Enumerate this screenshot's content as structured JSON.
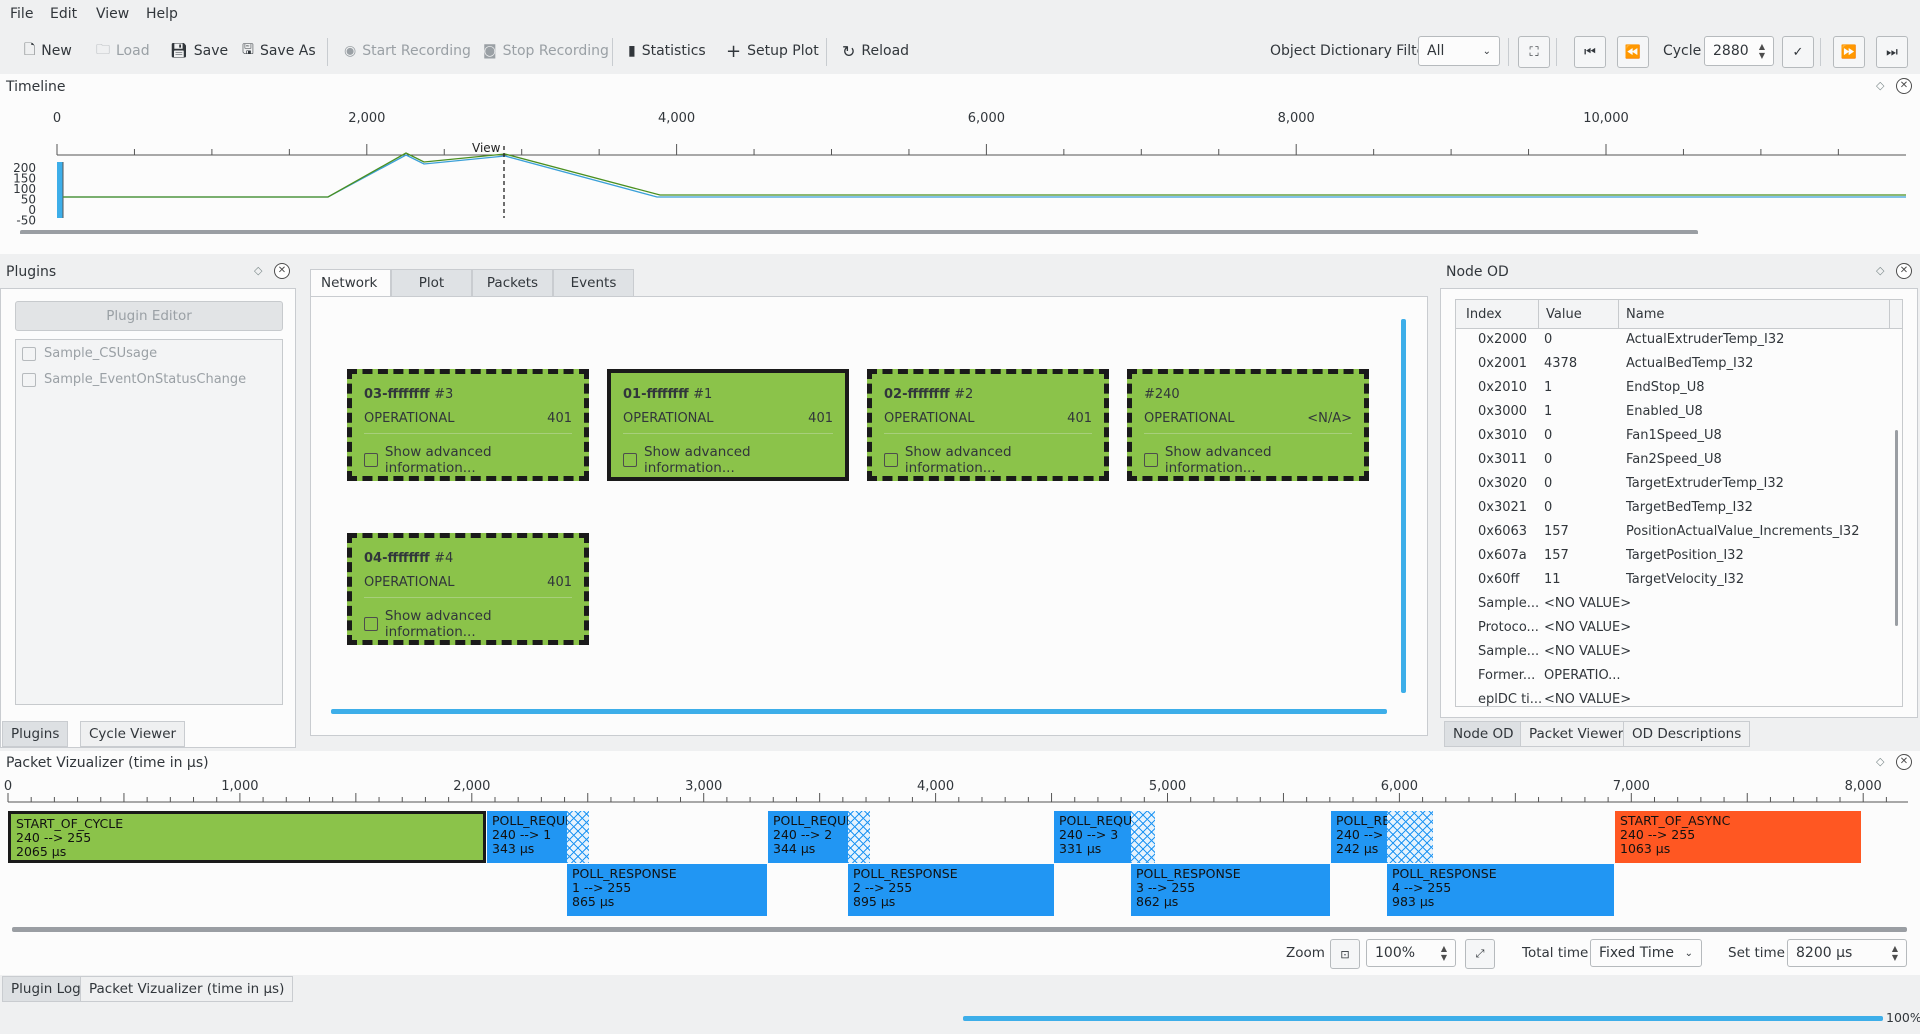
{
  "menu": {
    "file": "File",
    "edit": "Edit",
    "view": "View",
    "help": "Help"
  },
  "toolbar": {
    "new": "New",
    "load": "Load",
    "save": "Save",
    "save_as": "Save As",
    "start_recording": "Start Recording",
    "stop_recording": "Stop Recording",
    "statistics": "Statistics",
    "setup_plot": "Setup Plot",
    "reload": "Reload",
    "od_filter_label": "Object Dictionary Filter",
    "od_filter_value": "All",
    "cycle_label": "Cycle",
    "cycle_value": "2880"
  },
  "timeline": {
    "title": "Timeline",
    "x_ticks": [
      "0",
      "2,000",
      "4,000",
      "6,000",
      "8,000",
      "10,000"
    ],
    "y_ticks": [
      "200",
      "150",
      "100",
      "50",
      "0",
      "-50"
    ],
    "view_label": "View"
  },
  "plugins": {
    "title": "Plugins",
    "editor_button": "Plugin Editor",
    "items": [
      {
        "label": "Sample_CSUsage"
      },
      {
        "label": "Sample_EventOnStatusChange"
      }
    ],
    "tabs": [
      "Plugins",
      "Cycle Viewer"
    ]
  },
  "center_tabs": [
    "Network",
    "Plot",
    "Packets",
    "Events"
  ],
  "nodes": [
    {
      "title": "03-ffffffff",
      "num": "#3",
      "state": "OPERATIONAL",
      "value": "401",
      "adv": "Show advanced information..."
    },
    {
      "title": "01-ffffffff",
      "num": "#1",
      "state": "OPERATIONAL",
      "value": "401",
      "adv": "Show advanced information..."
    },
    {
      "title": "02-ffffffff",
      "num": "#2",
      "state": "OPERATIONAL",
      "value": "401",
      "adv": "Show advanced information..."
    },
    {
      "title": "",
      "num": "#240",
      "state": "OPERATIONAL",
      "value": "<N/A>",
      "adv": "Show advanced information..."
    },
    {
      "title": "04-ffffffff",
      "num": "#4",
      "state": "OPERATIONAL",
      "value": "401",
      "adv": "Show advanced information..."
    }
  ],
  "node_od": {
    "title": "Node OD",
    "headers": [
      "Index",
      "Value",
      "Name"
    ],
    "rows": [
      {
        "index": "0x2000",
        "value": "0",
        "name": "ActualExtruderTemp_I32"
      },
      {
        "index": "0x2001",
        "value": "4378",
        "name": "ActualBedTemp_I32"
      },
      {
        "index": "0x2010",
        "value": "1",
        "name": "EndStop_U8"
      },
      {
        "index": "0x3000",
        "value": "1",
        "name": "Enabled_U8"
      },
      {
        "index": "0x3010",
        "value": "0",
        "name": "Fan1Speed_U8"
      },
      {
        "index": "0x3011",
        "value": "0",
        "name": "Fan2Speed_U8"
      },
      {
        "index": "0x3020",
        "value": "0",
        "name": "TargetExtruderTemp_I32"
      },
      {
        "index": "0x3021",
        "value": "0",
        "name": "TargetBedTemp_I32"
      },
      {
        "index": "0x6063",
        "value": "157",
        "name": "PositionActualValue_Increments_I32"
      },
      {
        "index": "0x607a",
        "value": "157",
        "name": "TargetPosition_I32"
      },
      {
        "index": "0x60ff",
        "value": "11",
        "name": "TargetVelocity_I32"
      },
      {
        "index": "Sample...",
        "value": "<NO VALUE>",
        "name": ""
      },
      {
        "index": "Protoco...",
        "value": "<NO VALUE>",
        "name": ""
      },
      {
        "index": "Sample...",
        "value": "<NO VALUE>",
        "name": ""
      },
      {
        "index": "Former...",
        "value": "OPERATIO...",
        "name": ""
      },
      {
        "index": "eplDC ti...",
        "value": "<NO VALUE>",
        "name": ""
      }
    ],
    "tabs": [
      "Node OD",
      "Packet Viewer",
      "OD Descriptions"
    ]
  },
  "packet_viz": {
    "title": "Packet Vizualizer (time in µs)",
    "x_ticks": [
      "0",
      "1,000",
      "2,000",
      "3,000",
      "4,000",
      "5,000",
      "6,000",
      "7,000",
      "8,000"
    ],
    "packets": [
      {
        "name": "START_OF_CYCLE",
        "route": "240 --> 255",
        "dur": "2065 µs"
      },
      {
        "name": "POLL_REQUEST",
        "route": "240 --> 1",
        "dur": "343 µs"
      },
      {
        "name": "POLL_RESPONSE",
        "route": "1 --> 255",
        "dur": "865 µs"
      },
      {
        "name": "POLL_REQUEST",
        "route": "240 --> 2",
        "dur": "344 µs"
      },
      {
        "name": "POLL_RESPONSE",
        "route": "2 --> 255",
        "dur": "895 µs"
      },
      {
        "name": "POLL_REQUEST",
        "route": "240 --> 3",
        "dur": "331 µs"
      },
      {
        "name": "POLL_RESPONSE",
        "route": "3 --> 255",
        "dur": "862 µs"
      },
      {
        "name": "POLL_REQUEST",
        "route": "240 --> 4",
        "dur": "242 µs"
      },
      {
        "name": "POLL_RESPONSE",
        "route": "4 --> 255",
        "dur": "983 µs"
      },
      {
        "name": "START_OF_ASYNC",
        "route": "240 --> 255",
        "dur": "1063 µs"
      }
    ],
    "zoom_label": "Zoom",
    "zoom_value": "100%",
    "total_time_label": "Total time",
    "total_time_value": "Fixed Time",
    "set_time_label": "Set time",
    "set_time_value": "8200 µs"
  },
  "bottom_tabs": [
    "Plugin Log",
    "Packet Vizualizer (time in µs)"
  ],
  "status": {
    "progress_label": "100%",
    "progress": 1.0
  },
  "colors": {
    "accent": "#3daee9",
    "node_green": "#8bc34a",
    "packet_blue": "#2196f3",
    "async_orange": "#ff5722"
  }
}
